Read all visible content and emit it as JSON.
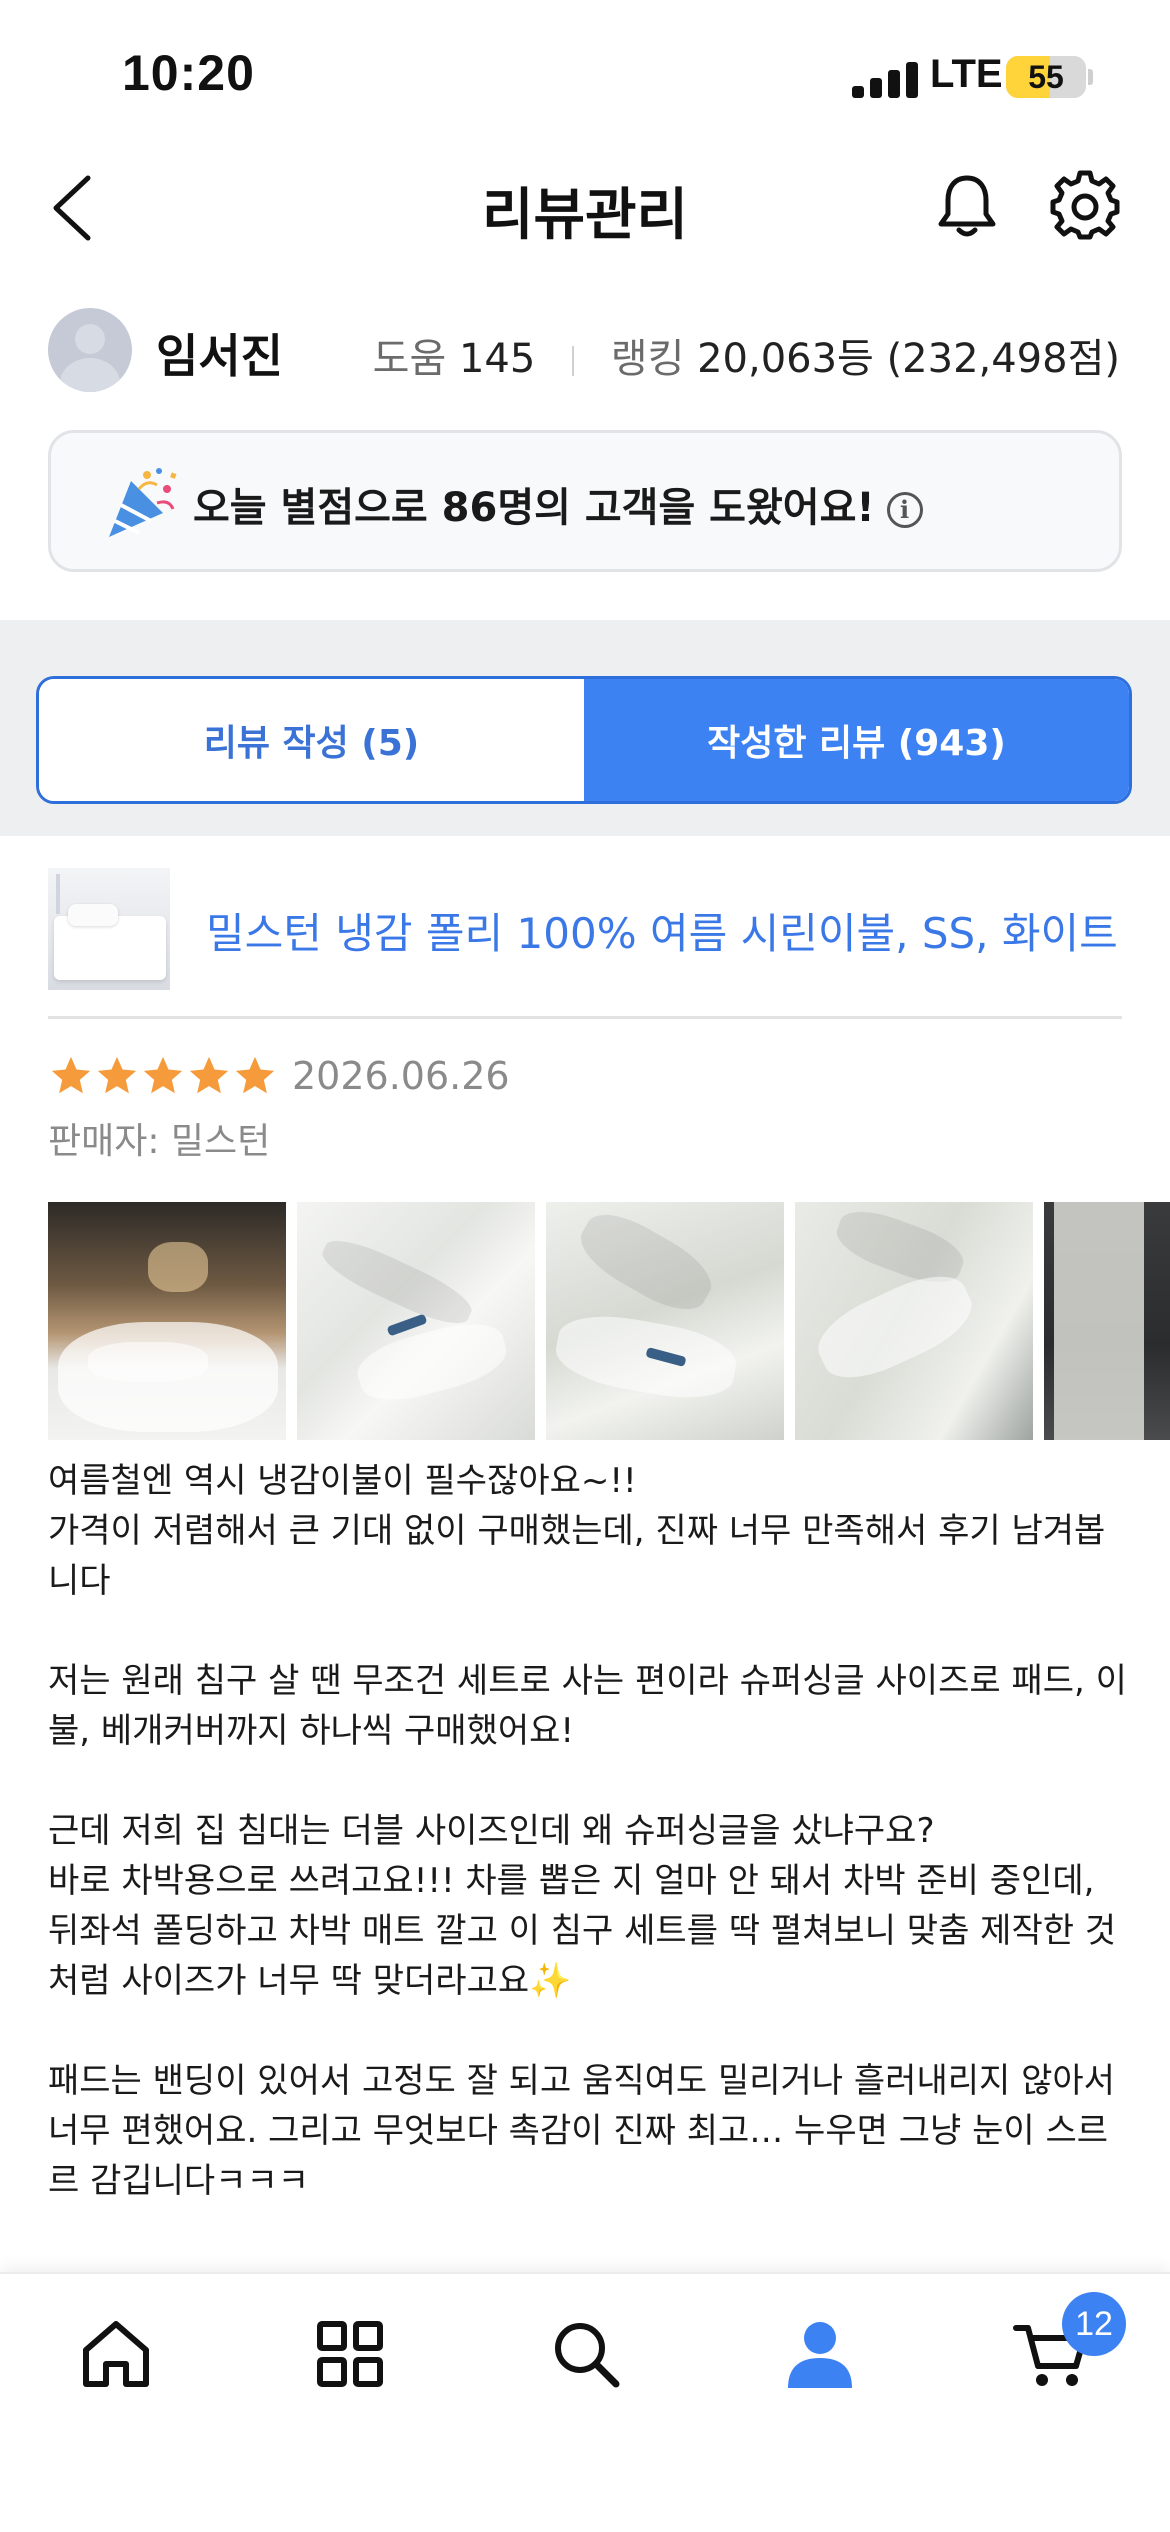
{
  "status_bar": {
    "time": "10:20",
    "network": "LTE",
    "battery": "55",
    "battery_level": 0.55
  },
  "header": {
    "title": "리뷰관리"
  },
  "profile": {
    "name": "임서진",
    "help_label": "도움",
    "help_value": "145",
    "ranking_label": "랭킹",
    "ranking_value": "20,063등 (232,498점)"
  },
  "notice": {
    "text": "오늘 별점으로 86명의 고객을 도왔어요!"
  },
  "tabs": [
    {
      "label": "리뷰 작성 (5)",
      "active": false
    },
    {
      "label": "작성한 리뷰 (943)",
      "active": true
    }
  ],
  "review": {
    "product_title": "밀스턴 냉감 폴리 100% 여름 시린이불, SS, 화이트",
    "rating": 5,
    "date": "2026.06.26",
    "seller": "판매자: 밀스턴",
    "photo_count_visible": 5,
    "paragraphs": [
      "여름철엔 역시 냉감이불이 필수잖아요~!!\n가격이 저렴해서 큰 기대 없이 구매했는데, 진짜 너무 만족해서 후기 남겨봅니다",
      "저는 원래 침구 살 땐 무조건 세트로 사는 편이라 슈퍼싱글 사이즈로 패드, 이불, 베개커버까지 하나씩 구매했어요!",
      "근데 저희 집 침대는 더블 사이즈인데 왜 슈퍼싱글을 샀냐구요?\n바로 차박용으로 쓰려고요!!! 차를 뽑은 지 얼마 안 돼서 차박 준비 중인데, 뒤좌석 폴딩하고 차박 매트 깔고 이 침구 세트를 딱 펼쳐보니 맞춤 제작한 것처럼 사이즈가 너무 딱 맞더라고요✨",
      "패드는 밴딩이 있어서 고정도 잘 되고 움직여도 밀리거나 흘러내리지 않아서 너무 편했어요. 그리고 무엇보다 촉감이 진짜 최고… 누우면 그냥 눈이 스르르 감깁니다ㅋㅋㅋ"
    ]
  },
  "bottom_nav": {
    "items": [
      "home-icon",
      "category-icon",
      "search-icon",
      "mypage-icon",
      "cart-icon"
    ],
    "active": "mypage-icon",
    "cart_badge": "12"
  },
  "colors": {
    "accent": "#3d82f2",
    "star": "#f59b3b",
    "link": "#3b78e7"
  }
}
